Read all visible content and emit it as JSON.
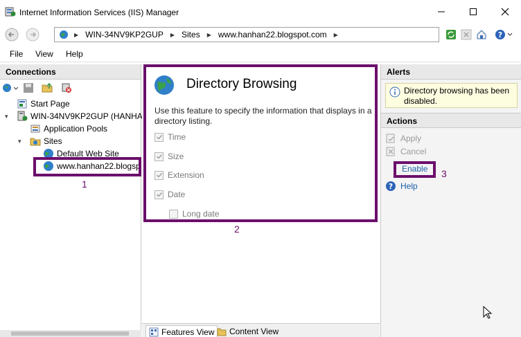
{
  "window": {
    "title": "Internet Information Services (IIS) Manager"
  },
  "address": {
    "crumbs": [
      "WIN-34NV9KP2GUP",
      "Sites",
      "www.hanhan22.blogspot.com"
    ]
  },
  "menu": {
    "items": [
      "File",
      "View",
      "Help"
    ]
  },
  "connections": {
    "header": "Connections",
    "tree": {
      "start_page": "Start Page",
      "server": "WIN-34NV9KP2GUP (HANHA",
      "app_pools": "Application Pools",
      "sites": "Sites",
      "default_site": "Default Web Site",
      "selected_site": "www.hanhan22.blogsp"
    }
  },
  "feature": {
    "title": "Directory Browsing",
    "description": "Use this feature to specify the information that displays in a directory listing.",
    "options": [
      {
        "label": "Time",
        "checked": true
      },
      {
        "label": "Size",
        "checked": true
      },
      {
        "label": "Extension",
        "checked": true
      },
      {
        "label": "Date",
        "checked": true
      },
      {
        "label": "Long date",
        "checked": false
      }
    ]
  },
  "tabs": {
    "features_view": "Features View",
    "content_view": "Content View"
  },
  "alerts": {
    "header": "Alerts",
    "message": "Directory browsing has been disabled."
  },
  "actions": {
    "header": "Actions",
    "apply": "Apply",
    "cancel": "Cancel",
    "enable": "Enable",
    "help": "Help"
  },
  "annotations": {
    "one": "1",
    "two": "2",
    "three": "3"
  },
  "colors": {
    "highlight": "#6b0f6b",
    "link": "#1a5ea8",
    "alert_bg": "#fdfde0"
  }
}
